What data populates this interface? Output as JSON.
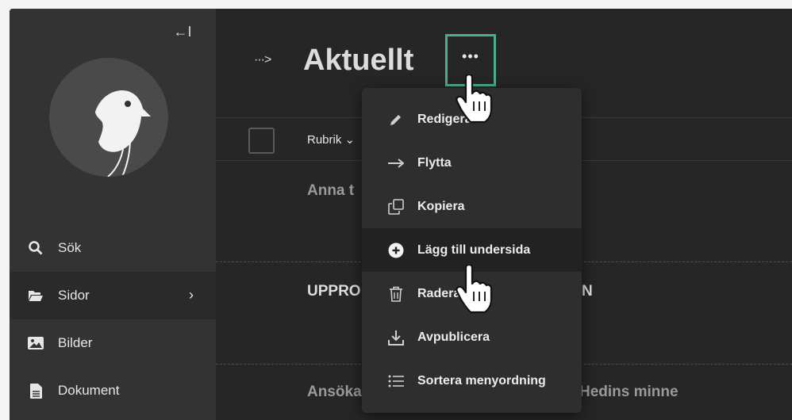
{
  "sidebar": {
    "collapse_icon": "collapse-left-icon",
    "collapse_label": "←I",
    "items": [
      {
        "label": "Sök",
        "icon": "search-icon"
      },
      {
        "label": "Sidor",
        "icon": "folder-open-icon",
        "active": true
      },
      {
        "label": "Bilder",
        "icon": "image-icon"
      },
      {
        "label": "Dokument",
        "icon": "document-icon"
      }
    ]
  },
  "main": {
    "expand_label": "···>",
    "title": "Aktuellt",
    "more_label": "•••",
    "columns": {
      "rubrik": "Rubrik"
    },
    "rows": [
      {
        "text": "Anna t"
      },
      {
        "text": "UPPRO",
        "suffix": "N"
      },
      {
        "text": "Ansöka",
        "suffix": "Hedins minne"
      }
    ]
  },
  "menu": {
    "items": [
      {
        "label": "Redigera",
        "icon": "pencil-icon"
      },
      {
        "label": "Flytta",
        "icon": "arrow-right-icon"
      },
      {
        "label": "Kopiera",
        "icon": "copy-icon"
      },
      {
        "label": "Lägg till undersida",
        "icon": "plus-circle-icon",
        "highlighted": true
      },
      {
        "label": "Radera",
        "icon": "trash-icon"
      },
      {
        "label": "Avpublicera",
        "icon": "download-icon"
      },
      {
        "label": "Sortera menyordning",
        "icon": "list-icon"
      }
    ]
  },
  "colors": {
    "accent": "#4caf8c",
    "sidebar_bg": "#333333",
    "main_bg": "#262626",
    "menu_bg": "#2e2e2e"
  }
}
